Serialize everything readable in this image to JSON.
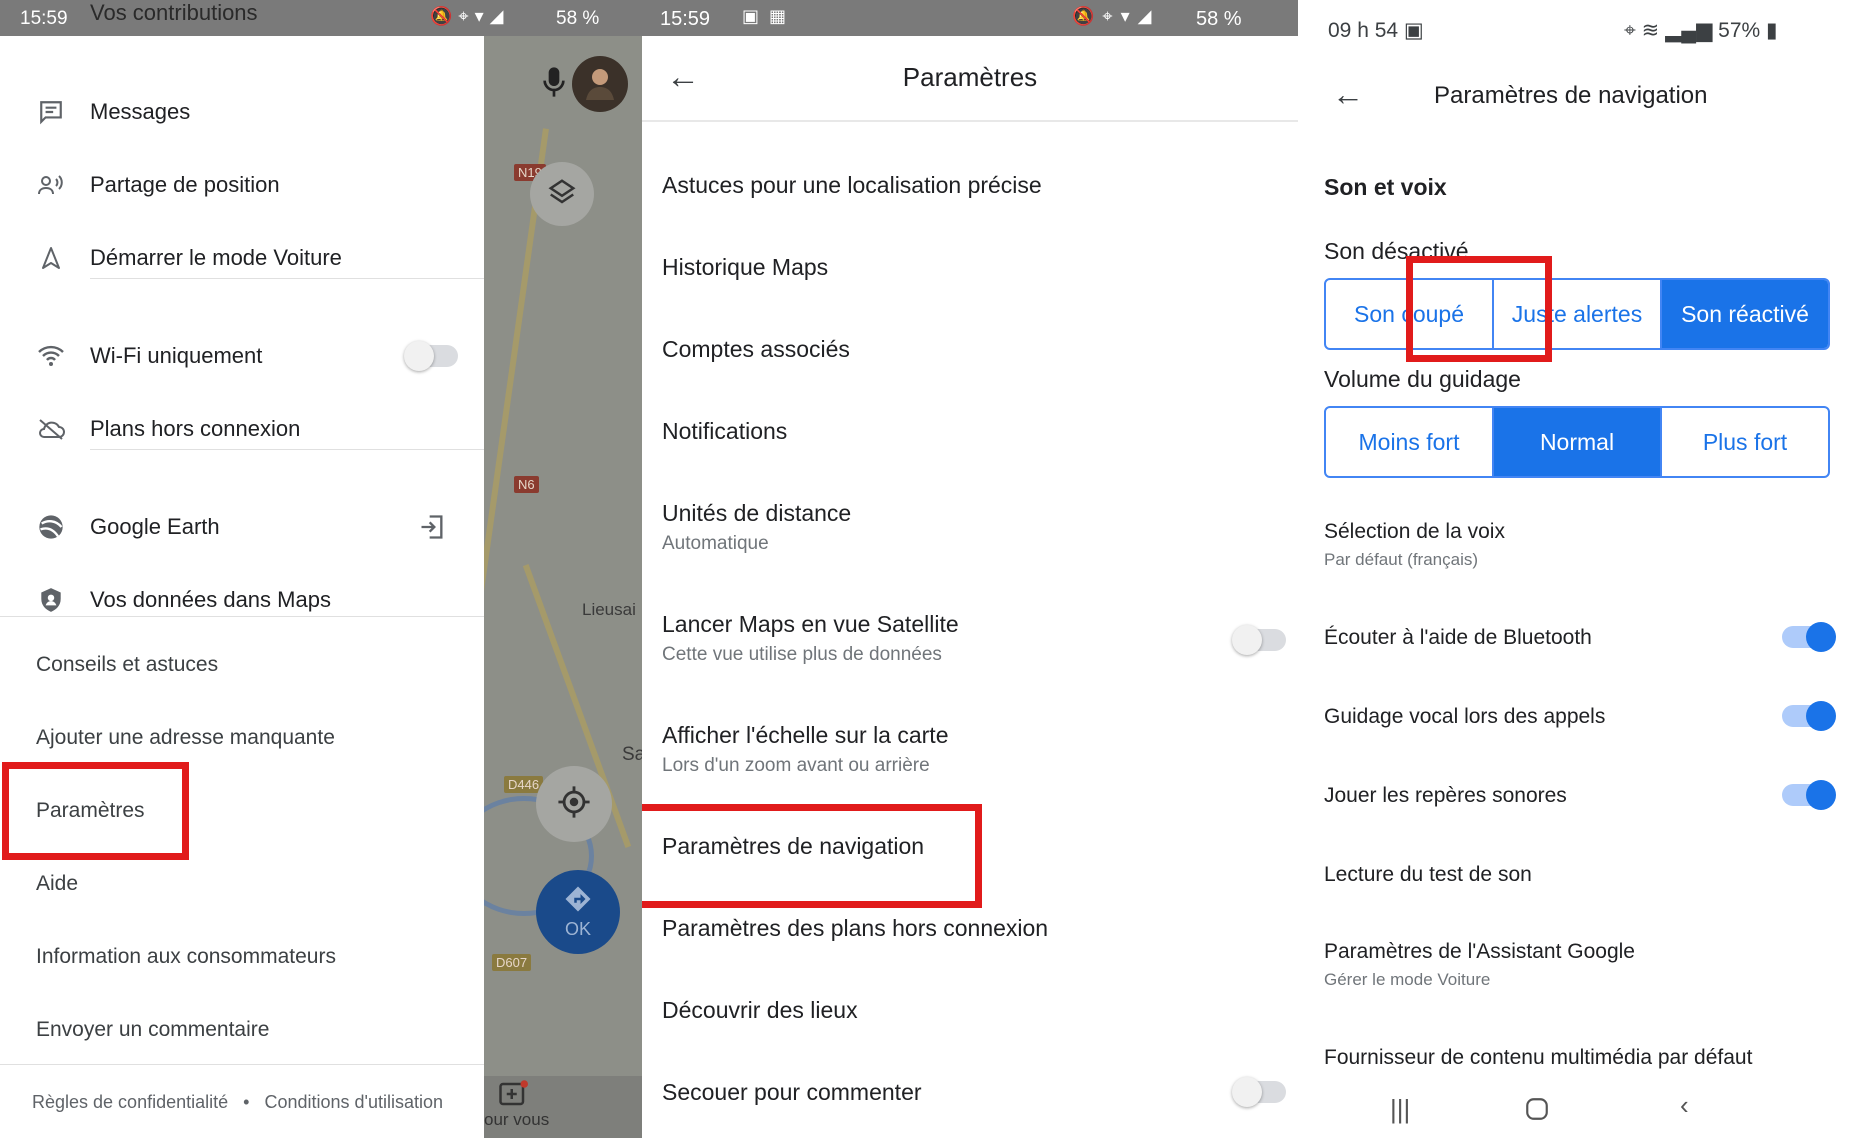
{
  "panel1": {
    "status": {
      "time": "15:59",
      "battery": "58 %",
      "overlay_title": "Vos contributions"
    },
    "menu_group1": [
      {
        "label": "Messages",
        "icon": "message-icon"
      },
      {
        "label": "Partage de position",
        "icon": "location-sharing-icon"
      },
      {
        "label": "Démarrer le mode Voiture",
        "icon": "navigation-arrow-icon"
      }
    ],
    "menu_group2": [
      {
        "label": "Wi-Fi uniquement",
        "icon": "wifi-icon",
        "toggle": false
      },
      {
        "label": "Plans hors connexion",
        "icon": "offline-cloud-icon"
      }
    ],
    "menu_group3": [
      {
        "label": "Google Earth",
        "icon": "google-earth-icon"
      },
      {
        "label": "Vos données dans Maps",
        "icon": "shield-icon"
      }
    ],
    "plain_items": [
      "Conseils et astuces",
      "Ajouter une adresse manquante",
      "Paramètres",
      "Aide",
      "Information aux consommateurs",
      "Envoyer un commentaire"
    ],
    "footer": {
      "privacy": "Règles de confidentialité",
      "separator": "•",
      "terms": "Conditions d'utilisation"
    },
    "map": {
      "badges": [
        "N19",
        "N6",
        "D446",
        "D607"
      ],
      "place_partial": "Lieusai",
      "place_partial2": "Sa",
      "go_label": "OK",
      "foryou_label": "our vous"
    }
  },
  "panel2": {
    "status": {
      "time": "15:59",
      "battery": "58 %"
    },
    "title": "Paramètres",
    "items": [
      {
        "title": "Astuces pour une localisation précise"
      },
      {
        "title": "Historique Maps"
      },
      {
        "title": "Comptes associés"
      },
      {
        "title": "Notifications"
      },
      {
        "title": "Unités de distance",
        "subtitle": "Automatique"
      },
      {
        "title": "Lancer Maps en vue Satellite",
        "subtitle": "Cette vue utilise plus de données",
        "toggle": false
      },
      {
        "title": "Afficher l'échelle sur la carte",
        "subtitle": "Lors d'un zoom avant ou arrière"
      },
      {
        "title": "Paramètres de navigation"
      },
      {
        "title": "Paramètres des plans hors connexion"
      },
      {
        "title": "Découvrir des lieux"
      },
      {
        "title": "Secouer pour commenter",
        "toggle": false
      }
    ]
  },
  "panel3": {
    "status": {
      "time": "09 h 54",
      "battery": "57%"
    },
    "title": "Paramètres de navigation",
    "section": "Son et voix",
    "sound_label": "Son désactivé",
    "sound_options": [
      "Son coupé",
      "Juste alertes",
      "Son réactivé"
    ],
    "sound_selected": 2,
    "volume_label": "Volume du guidage",
    "volume_options": [
      "Moins fort",
      "Normal",
      "Plus fort"
    ],
    "volume_selected": 1,
    "voice": {
      "title": "Sélection de la voix",
      "subtitle": "Par défaut (français)"
    },
    "toggles": [
      {
        "label": "Écouter à l'aide de Bluetooth",
        "on": true
      },
      {
        "label": "Guidage vocal lors des appels",
        "on": true
      },
      {
        "label": "Jouer les repères sonores",
        "on": true
      }
    ],
    "sound_test": "Lecture du test de son",
    "assistant": {
      "title": "Paramètres de l'Assistant Google",
      "subtitle": "Gérer le mode Voiture"
    },
    "media_provider": "Fournisseur de contenu multimédia par défaut"
  },
  "colors": {
    "accent": "#1a73e8",
    "highlight": "#e11b1b",
    "statusbar": "#7a7a7a"
  }
}
